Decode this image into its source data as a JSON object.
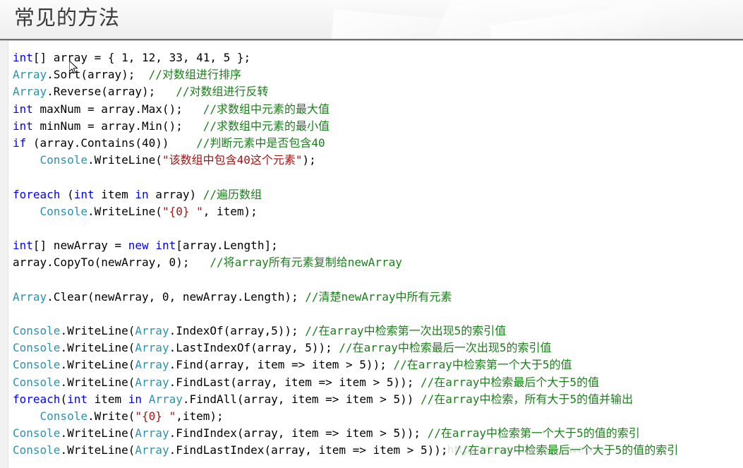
{
  "slide": {
    "title": "常见的方法",
    "watermark": "https://blog.csdn.net/weixin_"
  },
  "colors": {
    "keyword": "#0000FF",
    "type": "#2B91AF",
    "string": "#A31515",
    "comment": "#1A7F1A",
    "plain": "#000000",
    "header_rule": "#6F7072",
    "background": "#FFFFFF"
  },
  "code": {
    "language": "csharp",
    "lines": [
      {
        "index": 1,
        "text": "int[] array = { 1, 12, 33, 41, 5 };",
        "tokens": [
          {
            "t": "int",
            "c": "k"
          },
          {
            "t": "[] array = { 1, 12, 33, 41, 5 };",
            "c": "p"
          }
        ]
      },
      {
        "index": 2,
        "text": "Array.Sort(array); //对数组进行排序",
        "tokens": [
          {
            "t": "Array",
            "c": "t"
          },
          {
            "t": ".Sort(array);  ",
            "c": "p"
          },
          {
            "t": "//对数组进行排序",
            "c": "c"
          }
        ]
      },
      {
        "index": 3,
        "text": "Array.Reverse(array);   //对数组进行反转",
        "tokens": [
          {
            "t": "Array",
            "c": "t"
          },
          {
            "t": ".Reverse(array);   ",
            "c": "p"
          },
          {
            "t": "//对数组进行反转",
            "c": "c"
          }
        ]
      },
      {
        "index": 4,
        "text": "int maxNum = array.Max();   //求数组中元素的最大值",
        "tokens": [
          {
            "t": "int",
            "c": "k"
          },
          {
            "t": " maxNum = array.Max();   ",
            "c": "p"
          },
          {
            "t": "//求数组中元素的最大值",
            "c": "c"
          }
        ]
      },
      {
        "index": 5,
        "text": "int minNum = array.Min();   //求数组中元素的最小值",
        "tokens": [
          {
            "t": "int",
            "c": "k"
          },
          {
            "t": " minNum = array.Min();   ",
            "c": "p"
          },
          {
            "t": "//求数组中元素的最小值",
            "c": "c"
          }
        ]
      },
      {
        "index": 6,
        "text": "if (array.Contains(40))    //判断元素中是否包含40",
        "tokens": [
          {
            "t": "if",
            "c": "k"
          },
          {
            "t": " (array.Contains(40))    ",
            "c": "p"
          },
          {
            "t": "//判断元素中是否包含40",
            "c": "c"
          }
        ]
      },
      {
        "index": 7,
        "text": "    Console.WriteLine(\"该数组中包含40这个元素\");",
        "tokens": [
          {
            "t": "    ",
            "c": "p"
          },
          {
            "t": "Console",
            "c": "t"
          },
          {
            "t": ".WriteLine(",
            "c": "p"
          },
          {
            "t": "\"该数组中包含40这个元素\"",
            "c": "s"
          },
          {
            "t": ");",
            "c": "p"
          }
        ]
      },
      {
        "index": 8,
        "text": "",
        "tokens": []
      },
      {
        "index": 9,
        "text": "foreach (int item in array) //遍历数组",
        "tokens": [
          {
            "t": "foreach",
            "c": "k"
          },
          {
            "t": " (",
            "c": "p"
          },
          {
            "t": "int",
            "c": "k"
          },
          {
            "t": " item ",
            "c": "p"
          },
          {
            "t": "in",
            "c": "k"
          },
          {
            "t": " array) ",
            "c": "p"
          },
          {
            "t": "//遍历数组",
            "c": "c"
          }
        ]
      },
      {
        "index": 10,
        "text": "    Console.WriteLine(\"{0} \", item);",
        "tokens": [
          {
            "t": "    ",
            "c": "p"
          },
          {
            "t": "Console",
            "c": "t"
          },
          {
            "t": ".WriteLine(",
            "c": "p"
          },
          {
            "t": "\"{0} \"",
            "c": "s"
          },
          {
            "t": ", item);",
            "c": "p"
          }
        ]
      },
      {
        "index": 11,
        "text": "",
        "tokens": []
      },
      {
        "index": 12,
        "text": "int[] newArray = new int[array.Length];",
        "tokens": [
          {
            "t": "int",
            "c": "k"
          },
          {
            "t": "[] newArray = ",
            "c": "p"
          },
          {
            "t": "new",
            "c": "k"
          },
          {
            "t": " ",
            "c": "p"
          },
          {
            "t": "int",
            "c": "k"
          },
          {
            "t": "[array.Length];",
            "c": "p"
          }
        ]
      },
      {
        "index": 13,
        "text": "array.CopyTo(newArray, 0);   //将array所有元素复制给newArray",
        "tokens": [
          {
            "t": "array.CopyTo(newArray, 0);   ",
            "c": "p"
          },
          {
            "t": "//将array所有元素复制给newArray",
            "c": "c"
          }
        ]
      },
      {
        "index": 14,
        "text": "",
        "tokens": []
      },
      {
        "index": 15,
        "text": "Array.Clear(newArray, 0, newArray.Length); //清楚newArray中所有元素",
        "tokens": [
          {
            "t": "Array",
            "c": "t"
          },
          {
            "t": ".Clear(newArray, 0, newArray.Length); ",
            "c": "p"
          },
          {
            "t": "//清楚newArray中所有元素",
            "c": "c"
          }
        ]
      },
      {
        "index": 16,
        "text": "",
        "tokens": []
      },
      {
        "index": 17,
        "text": "Console.WriteLine(Array.IndexOf(array,5)); //在array中检索第一次出现5的索引值",
        "tokens": [
          {
            "t": "Console",
            "c": "t"
          },
          {
            "t": ".WriteLine(",
            "c": "p"
          },
          {
            "t": "Array",
            "c": "t"
          },
          {
            "t": ".IndexOf(array,5)); ",
            "c": "p"
          },
          {
            "t": "//在array中检索第一次出现5的索引值",
            "c": "c"
          }
        ]
      },
      {
        "index": 18,
        "text": "Console.WriteLine(Array.LastIndexOf(array, 5)); //在array中检索最后一次出现5的索引值",
        "tokens": [
          {
            "t": "Console",
            "c": "t"
          },
          {
            "t": ".WriteLine(",
            "c": "p"
          },
          {
            "t": "Array",
            "c": "t"
          },
          {
            "t": ".LastIndexOf(array, 5)); ",
            "c": "p"
          },
          {
            "t": "//在array中检索最后一次出现5的索引值",
            "c": "c"
          }
        ]
      },
      {
        "index": 19,
        "text": "Console.WriteLine(Array.Find(array, item => item > 5)); //在array中检索第一个大于5的值",
        "tokens": [
          {
            "t": "Console",
            "c": "t"
          },
          {
            "t": ".WriteLine(",
            "c": "p"
          },
          {
            "t": "Array",
            "c": "t"
          },
          {
            "t": ".Find(array, item => item > 5)); ",
            "c": "p"
          },
          {
            "t": "//在array中检索第一个大于5的值",
            "c": "c"
          }
        ]
      },
      {
        "index": 20,
        "text": "Console.WriteLine(Array.FindLast(array, item => item > 5)); //在array中检索最后个大于5的值",
        "tokens": [
          {
            "t": "Console",
            "c": "t"
          },
          {
            "t": ".WriteLine(",
            "c": "p"
          },
          {
            "t": "Array",
            "c": "t"
          },
          {
            "t": ".FindLast(array, item => item > 5)); ",
            "c": "p"
          },
          {
            "t": "//在array中检索最后个大于5的值",
            "c": "c"
          }
        ]
      },
      {
        "index": 21,
        "text": "foreach(int item in Array.FindAll(array, item => item > 5)) //在array中检索，所有大于5的值并输出",
        "tokens": [
          {
            "t": "foreach",
            "c": "k"
          },
          {
            "t": "(",
            "c": "p"
          },
          {
            "t": "int",
            "c": "k"
          },
          {
            "t": " item ",
            "c": "p"
          },
          {
            "t": "in",
            "c": "k"
          },
          {
            "t": " ",
            "c": "p"
          },
          {
            "t": "Array",
            "c": "t"
          },
          {
            "t": ".FindAll(array, item => item > 5)) ",
            "c": "p"
          },
          {
            "t": "//在array中检索，所有大于5的值并输出",
            "c": "c"
          }
        ]
      },
      {
        "index": 22,
        "text": "    Console.Write(\"{0} \",item);",
        "tokens": [
          {
            "t": "    ",
            "c": "p"
          },
          {
            "t": "Console",
            "c": "t"
          },
          {
            "t": ".Write(",
            "c": "p"
          },
          {
            "t": "\"{0} \"",
            "c": "s"
          },
          {
            "t": ",item);",
            "c": "p"
          }
        ]
      },
      {
        "index": 23,
        "text": "Console.WriteLine(Array.FindIndex(array, item => item > 5)); //在array中检索第一个大于5的值的索引",
        "tokens": [
          {
            "t": "Console",
            "c": "t"
          },
          {
            "t": ".WriteLine(",
            "c": "p"
          },
          {
            "t": "Array",
            "c": "t"
          },
          {
            "t": ".FindIndex(array, item => item > 5)); ",
            "c": "p"
          },
          {
            "t": "//在array中检索第一个大于5的值的索引",
            "c": "c"
          }
        ]
      },
      {
        "index": 24,
        "text": "Console.WriteLine(Array.FindLastIndex(array, item => item > 5)); //在array中检索最后一个大于5的值的索引",
        "tokens": [
          {
            "t": "Console",
            "c": "t"
          },
          {
            "t": ".WriteLine(",
            "c": "p"
          },
          {
            "t": "Array",
            "c": "t"
          },
          {
            "t": ".FindLastIndex(array, item => item > 5)); ",
            "c": "p"
          },
          {
            "t": "//在array中检索最后一个大于5的值的索引",
            "c": "c"
          }
        ]
      }
    ]
  }
}
